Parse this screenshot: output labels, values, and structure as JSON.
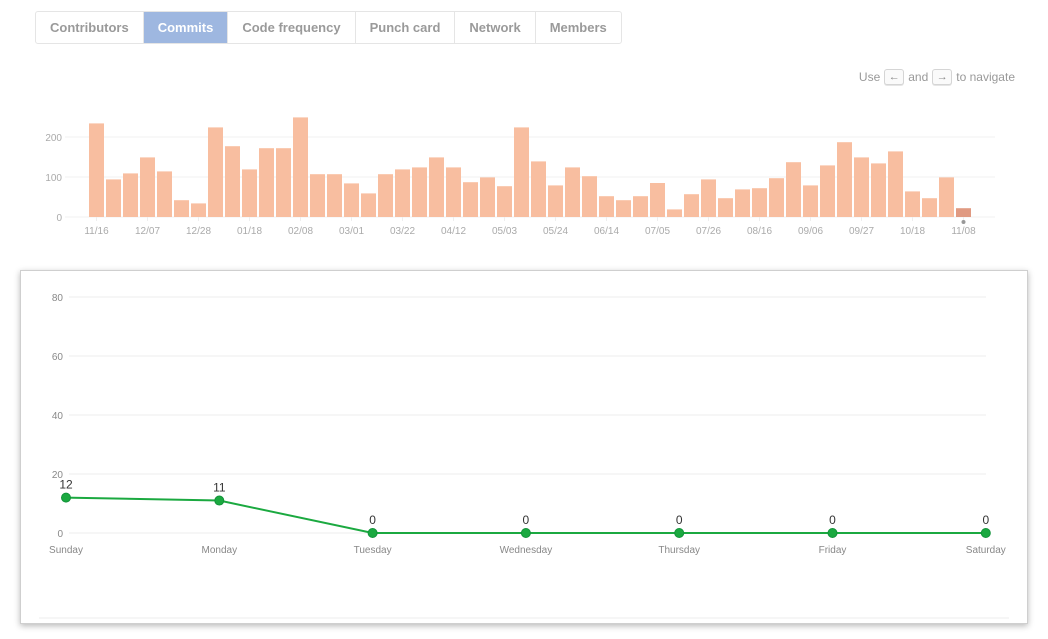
{
  "tabs": [
    {
      "label": "Contributors",
      "active": false
    },
    {
      "label": "Commits",
      "active": true
    },
    {
      "label": "Code frequency",
      "active": false
    },
    {
      "label": "Punch card",
      "active": false
    },
    {
      "label": "Network",
      "active": false
    },
    {
      "label": "Members",
      "active": false
    }
  ],
  "navigation_hint": {
    "prefix": "Use",
    "left_key": "←",
    "middle": "and",
    "right_key": "→",
    "suffix": "to navigate"
  },
  "colors": {
    "bar": "#f8bea0",
    "bar_selected": "#e09a82",
    "line": "#1ba940",
    "active_tab": "#9eb7e0"
  },
  "chart_data": [
    {
      "type": "bar",
      "title": "",
      "xlabel": "",
      "ylabel": "",
      "ylim": [
        0,
        250
      ],
      "yticks": [
        0,
        100,
        200
      ],
      "grid": true,
      "xtick_labels": [
        "11/16",
        "12/07",
        "12/28",
        "01/18",
        "02/08",
        "03/01",
        "03/22",
        "04/12",
        "05/03",
        "05/24",
        "06/14",
        "07/05",
        "07/26",
        "08/16",
        "09/06",
        "09/27",
        "10/18",
        "11/08"
      ],
      "xtick_every": 3,
      "selected_index": 51,
      "values": [
        234,
        94,
        109,
        149,
        114,
        42,
        34,
        224,
        177,
        119,
        172,
        172,
        249,
        107,
        107,
        84,
        59,
        107,
        119,
        124,
        149,
        124,
        87,
        99,
        77,
        224,
        139,
        79,
        124,
        102,
        52,
        42,
        52,
        85,
        19,
        57,
        94,
        47,
        69,
        72,
        97,
        137,
        79,
        129,
        187,
        149,
        134,
        164,
        64,
        47,
        99,
        22
      ]
    },
    {
      "type": "line",
      "title": "",
      "xlabel": "",
      "ylabel": "",
      "ylim": [
        0,
        80
      ],
      "yticks": [
        0,
        20,
        40,
        60,
        80
      ],
      "grid": true,
      "categories": [
        "Sunday",
        "Monday",
        "Tuesday",
        "Wednesday",
        "Thursday",
        "Friday",
        "Saturday"
      ],
      "values": [
        12,
        11,
        0,
        0,
        0,
        0,
        0
      ]
    }
  ]
}
